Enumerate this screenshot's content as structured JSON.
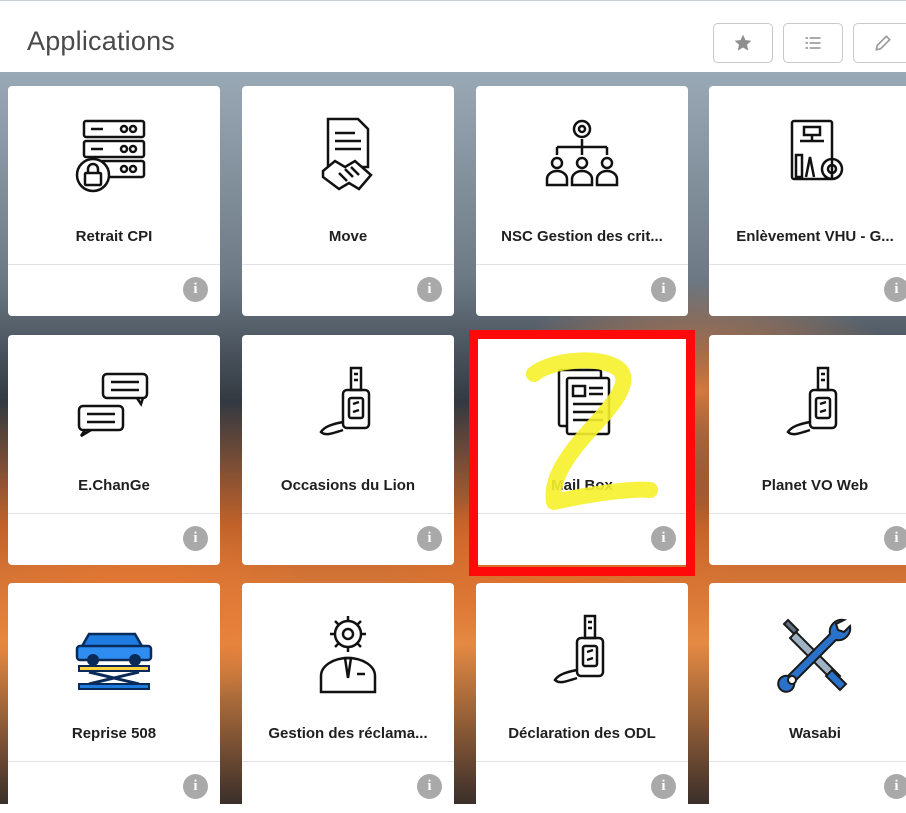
{
  "header": {
    "title": "Applications",
    "buttons": [
      {
        "icon": "star-icon"
      },
      {
        "icon": "list-icon"
      },
      {
        "icon": "pencil-icon"
      }
    ]
  },
  "tiles": [
    {
      "label": "Retrait CPI",
      "icon": "server-lock-icon"
    },
    {
      "label": "Move",
      "icon": "contract-handshake-icon"
    },
    {
      "label": "NSC Gestion des crit...",
      "icon": "org-chart-gear-icon"
    },
    {
      "label": "Enlèvement VHU - G...",
      "icon": "blueprint-gear-icon"
    },
    {
      "label": "E.ChanGe",
      "icon": "chat-bubbles-icon"
    },
    {
      "label": "Occasions du Lion",
      "icon": "car-key-icon"
    },
    {
      "label": "Mail Box",
      "icon": "documents-icon"
    },
    {
      "label": "Planet VO Web",
      "icon": "car-key-icon"
    },
    {
      "label": "Reprise 508",
      "icon": "car-lift-icon"
    },
    {
      "label": "Gestion des réclama...",
      "icon": "person-gear-icon"
    },
    {
      "label": "Déclaration des ODL",
      "icon": "car-key-icon"
    },
    {
      "label": "Wasabi",
      "icon": "tools-icon"
    }
  ],
  "annotation": {
    "color": "#ff0a0a",
    "scribble_color": "#f6f02a"
  }
}
